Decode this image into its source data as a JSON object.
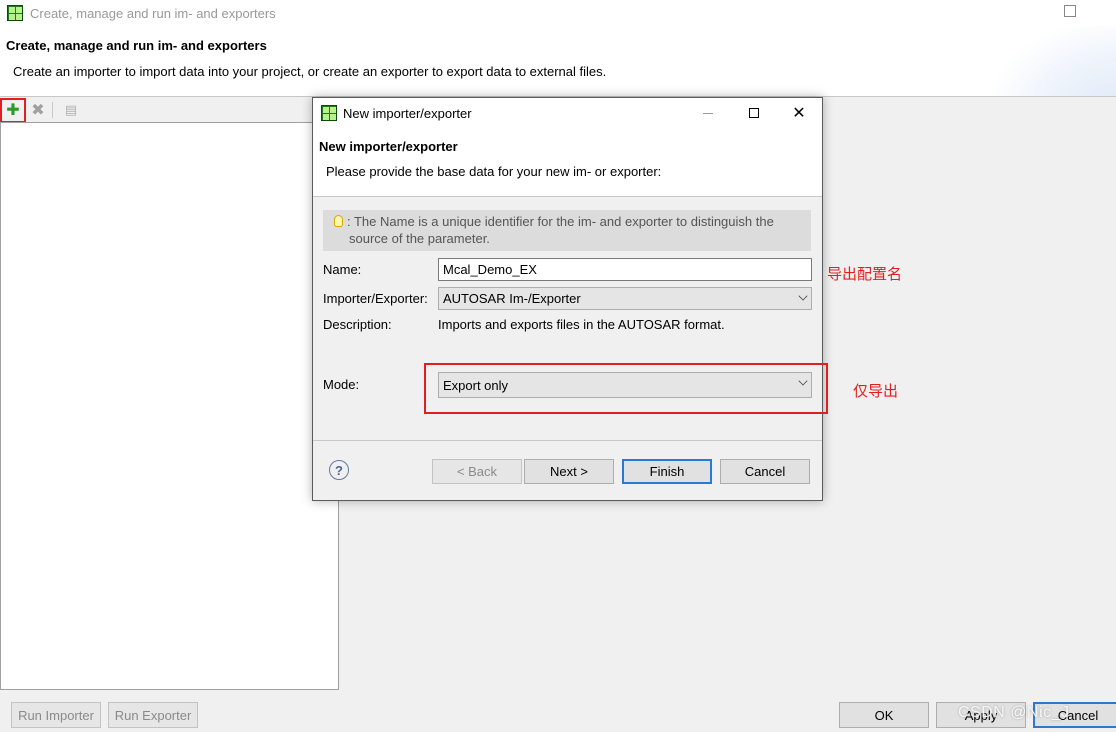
{
  "outer": {
    "window_title": "Create, manage and run im- and exporters",
    "header_title": "Create, manage and run im- and exporters",
    "header_desc": "Create an importer to import data into your project, or create an exporter to export data to external files.",
    "toolbar": {
      "add_glyph": "✚",
      "remove_glyph": "✖",
      "copy_glyph": "▤"
    },
    "buttons": {
      "run_importer": "Run Importer",
      "run_exporter": "Run Exporter",
      "ok": "OK",
      "apply": "Apply",
      "cancel": "Cancel"
    }
  },
  "dialog": {
    "window_title": "New importer/exporter",
    "close_glyph": "✕",
    "header_title": "New importer/exporter",
    "header_desc": "Please provide the base data for your new im- or exporter:",
    "info_line1": ": The Name is a unique identifier for the im- and exporter to distinguish the",
    "info_line2": "source of the parameter.",
    "fields": {
      "name_label": "Name:",
      "name_value": "Mcal_Demo_EX",
      "importer_exporter_label": "Importer/Exporter:",
      "importer_exporter_value": "AUTOSAR Im-/Exporter",
      "description_label": "Description:",
      "description_value": "Imports and exports files in the AUTOSAR format.",
      "mode_label": "Mode:",
      "mode_value": "Export only"
    },
    "help_glyph": "?",
    "buttons": {
      "back": "< Back",
      "next": "Next >",
      "finish": "Finish",
      "cancel": "Cancel"
    }
  },
  "annotations": {
    "name_note": "导出配置名",
    "mode_note": "仅导出"
  },
  "watermark": "CSDN @Nic_J",
  "colors": {
    "highlight_red": "#e02020",
    "focus_blue": "#2a7ad4",
    "app_icon_green": "#1d7a1d"
  }
}
